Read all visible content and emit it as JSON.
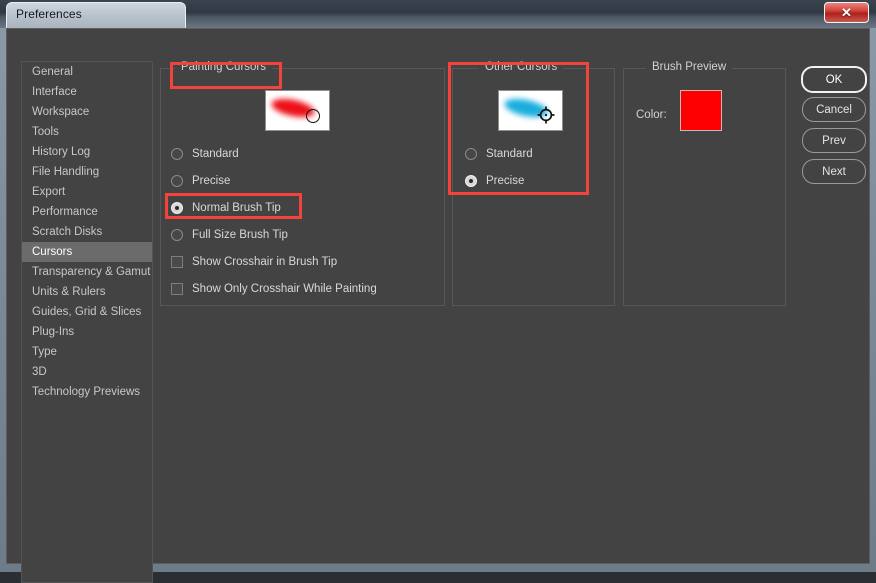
{
  "window": {
    "title": "Preferences",
    "close_label": "✕",
    "close_icon": "close-icon"
  },
  "sidebar": {
    "items": [
      {
        "label": "General",
        "selected": false
      },
      {
        "label": "Interface",
        "selected": false
      },
      {
        "label": "Workspace",
        "selected": false
      },
      {
        "label": "Tools",
        "selected": false
      },
      {
        "label": "History Log",
        "selected": false
      },
      {
        "label": "File Handling",
        "selected": false
      },
      {
        "label": "Export",
        "selected": false
      },
      {
        "label": "Performance",
        "selected": false
      },
      {
        "label": "Scratch Disks",
        "selected": false
      },
      {
        "label": "Cursors",
        "selected": true
      },
      {
        "label": "Transparency & Gamut",
        "selected": false
      },
      {
        "label": "Units & Rulers",
        "selected": false
      },
      {
        "label": "Guides, Grid & Slices",
        "selected": false
      },
      {
        "label": "Plug-Ins",
        "selected": false
      },
      {
        "label": "Type",
        "selected": false
      },
      {
        "label": "3D",
        "selected": false
      },
      {
        "label": "Technology Previews",
        "selected": false
      }
    ]
  },
  "painting_cursors": {
    "legend": "Painting Cursors",
    "preview_icon": "red-brush-stroke-with-round-brush-tip-cursor",
    "options": [
      {
        "label": "Standard",
        "type": "radio",
        "checked": false
      },
      {
        "label": "Precise",
        "type": "radio",
        "checked": false
      },
      {
        "label": "Normal Brush Tip",
        "type": "radio",
        "checked": true
      },
      {
        "label": "Full Size Brush Tip",
        "type": "radio",
        "checked": false
      },
      {
        "label": "Show Crosshair in Brush Tip",
        "type": "checkbox",
        "checked": false
      },
      {
        "label": "Show Only Crosshair While Painting",
        "type": "checkbox",
        "checked": false
      }
    ]
  },
  "other_cursors": {
    "legend": "Other Cursors",
    "preview_icon": "cyan-brush-stroke-with-crosshair-cursor",
    "options": [
      {
        "label": "Standard",
        "type": "radio",
        "checked": false
      },
      {
        "label": "Precise",
        "type": "radio",
        "checked": true
      }
    ]
  },
  "brush_preview": {
    "legend": "Brush Preview",
    "color_label": "Color:",
    "color_value": "#ff0000"
  },
  "buttons": [
    {
      "label": "OK",
      "primary": true
    },
    {
      "label": "Cancel",
      "primary": false
    },
    {
      "label": "Prev",
      "primary": false
    },
    {
      "label": "Next",
      "primary": false
    }
  ],
  "annotations": {
    "color": "#f4433a",
    "highlighted": [
      "Painting Cursors",
      "Other Cursors",
      "Normal Brush Tip"
    ]
  }
}
